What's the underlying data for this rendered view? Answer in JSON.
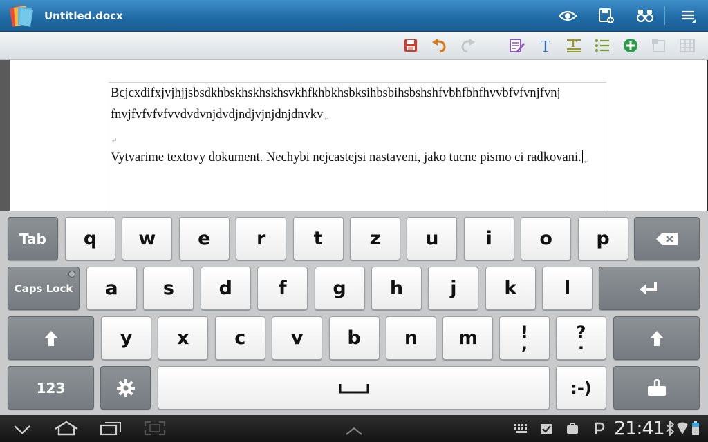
{
  "window": {
    "title": "Untitled.docx"
  },
  "colors": {
    "title_bar": "#1f6aa5",
    "toolbar": "#e7ebee",
    "keyboard": "#c8cacc",
    "key_dark": "#7d8387",
    "system_bar": "#1a1a1a"
  },
  "title_icons": [
    "eye-icon",
    "save-as-icon",
    "find-binoculars-icon",
    "menu-icon"
  ],
  "toolbar_icons": [
    "save-icon",
    "undo-icon",
    "redo-icon",
    "edit-document-icon",
    "text-format-icon",
    "paragraph-format-icon",
    "list-icon",
    "insert-icon",
    "insert-image-icon",
    "insert-table-icon"
  ],
  "document": {
    "paragraphs": [
      "Bcjcxdifxjvjhjjsbsdkhbskhskhskhsvkhfkhbkhsbksihbsbihsbshshfvbhfbhfhvvbfvfvnjfvnj fnvjfvfvfvfvvdvdvnjdvdjndjvjnjdnjdnvkv",
      "",
      "Vytvarime textovy dokument. Nechybi nejcastejsi nastaveni, jako tucne pismo ci radkovani."
    ]
  },
  "keyboard": {
    "row1": [
      "q",
      "w",
      "e",
      "r",
      "t",
      "z",
      "u",
      "i",
      "o",
      "p"
    ],
    "row2": [
      "a",
      "s",
      "d",
      "f",
      "g",
      "h",
      "j",
      "k",
      "l"
    ],
    "row3": [
      "y",
      "x",
      "c",
      "v",
      "b",
      "n",
      "m"
    ],
    "tab_label": "Tab",
    "caps_label": "Caps Lock",
    "num_label": "123",
    "smiley_label": ":-)",
    "excl_top": "!",
    "excl_bottom": ",",
    "quest_top": "?",
    "quest_bottom": "."
  },
  "system_bar": {
    "time": "21:41",
    "nav_icons": [
      "back-icon",
      "home-icon",
      "recent-apps-icon",
      "screenshot-icon"
    ],
    "status_icons": [
      "keyboard-icon",
      "download-done-icon",
      "bag-icon",
      "p-icon",
      "bluetooth-icon",
      "wifi-icon",
      "battery-icon"
    ]
  }
}
